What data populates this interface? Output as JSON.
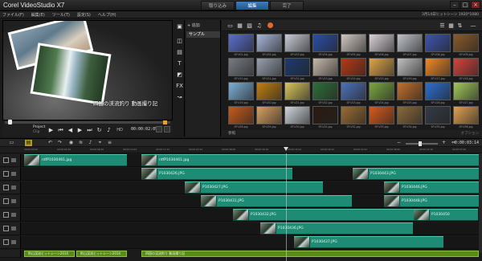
{
  "app": {
    "title": "Corel VideoStudio X7"
  },
  "tabs": [
    {
      "label": "取り込み"
    },
    {
      "label": "編集"
    },
    {
      "label": "完了"
    }
  ],
  "menu": {
    "items": [
      "ファイル(F)",
      "編集(E)",
      "ツール(T)",
      "設定(S)",
      "ヘルプ(H)"
    ],
    "status": "3月14日ヒットシーン 1920*1080"
  },
  "preview": {
    "caption": "四国の渓流釣り 動画撮り記"
  },
  "playback": {
    "project_label": "Project",
    "clip_label": "Clip",
    "hd_label": "HD",
    "timecode": "00:00:02:05",
    "progress": 0.02
  },
  "library": {
    "add_label": "追加",
    "folder_label": "サンプル",
    "browse_label": "参照",
    "status_right": "オプション",
    "thumbs": [
      {
        "label": "SP-V01.jpg",
        "color": "#5a6fd0"
      },
      {
        "label": "SP-V02.jpg",
        "color": "#a7b7d8"
      },
      {
        "label": "SP-V03.jpg",
        "color": "#c8ccd6"
      },
      {
        "label": "SP-V04.jpg",
        "color": "#2b4ea8"
      },
      {
        "label": "SP-V05.jpg",
        "color": "#d0c8c2"
      },
      {
        "label": "SP-V06.jpg",
        "color": "#d9d2d8"
      },
      {
        "label": "SP-V07.jpg",
        "color": "#bfc3c9"
      },
      {
        "label": "SP-V08.jpg",
        "color": "#3e54b0"
      },
      {
        "label": "SP-V09.jpg",
        "color": "#8a5a2a"
      },
      {
        "label": "SP-V10.jpg",
        "color": "#777b83"
      },
      {
        "label": "SP-V11.jpg",
        "color": "#96a0ae"
      },
      {
        "label": "SP-V12.jpg",
        "color": "#1c3b6e"
      },
      {
        "label": "SP-V13.jpg",
        "color": "#c6b8aa"
      },
      {
        "label": "SP-V14.jpg",
        "color": "#b73a16"
      },
      {
        "label": "SP-V15.jpg",
        "color": "#dfa54a"
      },
      {
        "label": "SP-V16.jpg",
        "color": "#c0c0c0"
      },
      {
        "label": "SP-V17.jpg",
        "color": "#f08a2a"
      },
      {
        "label": "SP-V18.jpg",
        "color": "#d4453c"
      },
      {
        "label": "SP-V19.jpg",
        "color": "#7bb0d6"
      },
      {
        "label": "SP-V20.jpg",
        "color": "#c08010"
      },
      {
        "label": "SP-V21.jpg",
        "color": "#d7c65c"
      },
      {
        "label": "SP-V22.jpg",
        "color": "#2e6e3a"
      },
      {
        "label": "SP-V23.jpg",
        "color": "#4c72b8"
      },
      {
        "label": "SP-V24.jpg",
        "color": "#7aa840"
      },
      {
        "label": "SP-V25.jpg",
        "color": "#c3702a"
      },
      {
        "label": "SP-V26.jpg",
        "color": "#2c6fd0"
      },
      {
        "label": "SP-V27.jpg",
        "color": "#a2c85a"
      },
      {
        "label": "SP-V28.jpg",
        "color": "#c85a1a"
      },
      {
        "label": "SP-V29.jpg",
        "color": "#d8a060"
      },
      {
        "label": "SP-V30.jpg",
        "color": "#cfd6dc"
      },
      {
        "label": "SP-V31.jpg",
        "color": "#2a1a10"
      },
      {
        "label": "SP-V32.jpg",
        "color": "#9a6b34"
      },
      {
        "label": "SP-V33.jpg",
        "color": "#d95a1a"
      },
      {
        "label": "SP-V34.jpg",
        "color": "#8a6a3a"
      },
      {
        "label": "SP-V35.jpg",
        "color": "#333b45"
      },
      {
        "label": "SP-V36.jpg",
        "color": "#e0a050"
      }
    ]
  },
  "timeline": {
    "timecode": "0:00:03:14",
    "ruler": [
      "00:00:00:00",
      "00:00:04:10",
      "00:00:08:20",
      "00:00:13:04",
      "00:00:17:14",
      "00:00:21:24",
      "00:00:26:08",
      "00:00:30:18",
      "00:00:35:02",
      "00:00:39:12",
      "00:00:43:22",
      "00:00:48:06",
      "00:00:52:16",
      "00:00:57:00"
    ],
    "tracks": [
      {
        "clips": [
          {
            "label": "rdfP1030461.jpg"
          },
          {
            "label": "rdfP1030461.jpg"
          }
        ]
      },
      {
        "clips": [
          {
            "label": "P1030426.JPG"
          },
          {
            "label": "P1030443.JPG"
          }
        ]
      },
      {
        "clips": [
          {
            "label": "P1030427.JPG"
          },
          {
            "label": "P1030446.JPG"
          }
        ]
      },
      {
        "clips": [
          {
            "label": "P1030431.JPG"
          },
          {
            "label": "P1030448.JPG"
          }
        ]
      },
      {
        "clips": [
          {
            "label": "P1030432.JPG"
          },
          {
            "label": "P1030450"
          }
        ]
      },
      {
        "clips": [
          {
            "label": "P1030436.JPG"
          }
        ]
      },
      {
        "clips": [
          {
            "label": "P1030437.JPG"
          }
        ]
      }
    ],
    "titles": [
      {
        "label": "釣山渓流ヒットシーン2014"
      },
      {
        "label": "釣山渓流ヒットシーン2014"
      },
      {
        "label": "四国の渓流釣り 動画撮り記"
      }
    ]
  }
}
